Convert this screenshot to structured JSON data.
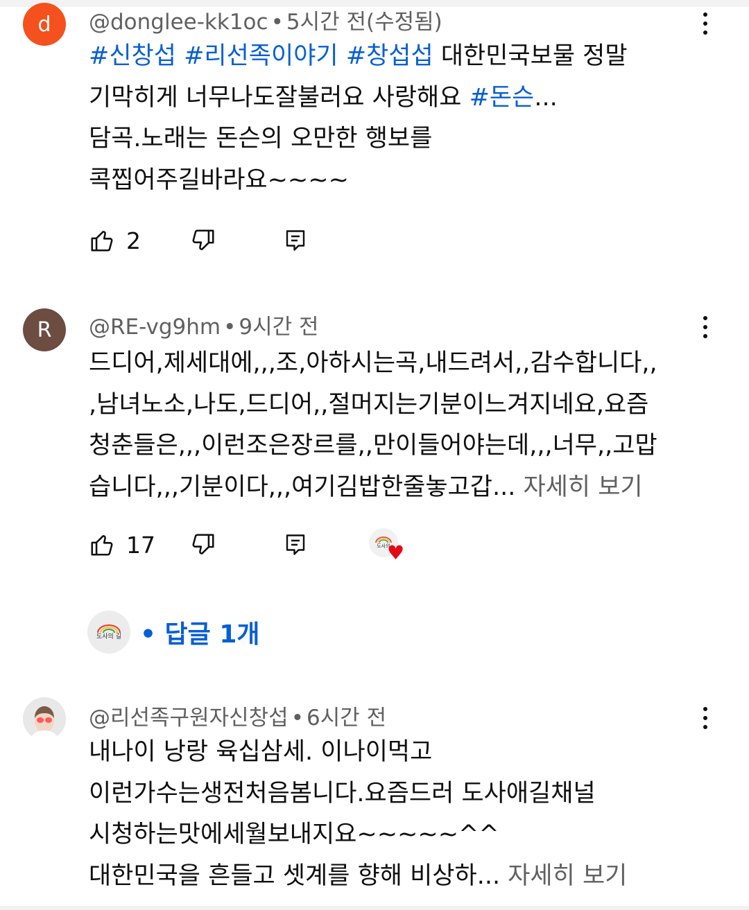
{
  "comments": [
    {
      "avatar_letter": "d",
      "avatar_color": "#f4511e",
      "author": "@donglee-kk1oc",
      "time": "5시간 전(수정됨)",
      "lines": [
        [
          {
            "t": "#신창섭",
            "tag": true
          },
          {
            "t": " "
          },
          {
            "t": "#리선족이야기",
            "tag": true
          },
          {
            "t": " "
          },
          {
            "t": "#창섭섭",
            "tag": true
          },
          {
            "t": " 대한민국보물 정말"
          }
        ],
        [
          {
            "t": "기막히게 너무나도잘불러요 사랑해요 "
          },
          {
            "t": "#돈슨",
            "tag": true
          },
          {
            "t": "..."
          }
        ],
        [
          {
            "t": "담곡.노래는 돈슨의 오만한 행보를"
          }
        ],
        [
          {
            "t": "콕찝어주길바라요~~~~"
          }
        ]
      ],
      "likes": "2"
    },
    {
      "avatar_letter": "R",
      "avatar_color": "#6d4c41",
      "author": "@RE-vg9hm",
      "time": "9시간 전",
      "lines": [
        [
          {
            "t": "드디어,제세대에,,,조,아하시는곡,내드려서,,감수합니다,,"
          }
        ],
        [
          {
            "t": ",남녀노소,나도,드디어,,절머지는기분이느겨지네요,요즘"
          }
        ],
        [
          {
            "t": "청춘들은,,,이런조은장르를,,만이들어야는데,,,너무,,고맙"
          }
        ],
        [
          {
            "t": "습니다,,,기분이다,,,여기김밥한줄놓고갑... "
          },
          {
            "t": "자세히 보기",
            "more": true
          }
        ]
      ],
      "likes": "17",
      "creator_heart_text": "도사의",
      "replies_logo_text": "도사의 길",
      "replies_label": "• 답글 1개"
    },
    {
      "author": "@리선족구원자신창섭",
      "time": "6시간 전",
      "lines": [
        [
          {
            "t": "내나이 낭랑 육십삼세. 이나이먹고"
          }
        ],
        [
          {
            "t": "이런가수는생전처음봄니다.요즘드러 도사애길채널"
          }
        ],
        [
          {
            "t": "시청하는맛에세월보내지요~~~~~^^"
          }
        ],
        [
          {
            "t": "대한민국을 흔들고 셋계를 향해 비상하... "
          },
          {
            "t": "자세히 보기",
            "more": true
          }
        ]
      ]
    }
  ],
  "separator": "•",
  "icons": [
    "thumb-up-icon",
    "thumb-down-icon",
    "reply-icon",
    "more-vert-icon",
    "heart-icon"
  ]
}
